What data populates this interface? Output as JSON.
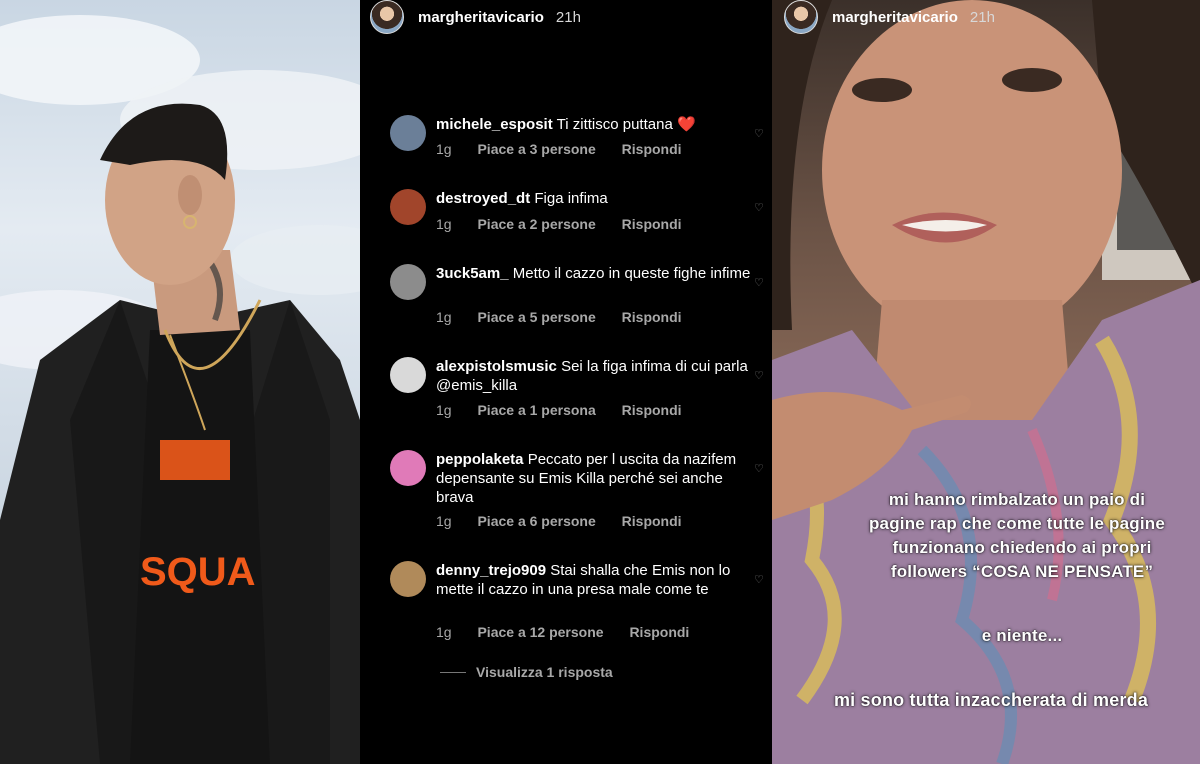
{
  "story": {
    "username": "margheritavicario",
    "time": "21h"
  },
  "comments": [
    {
      "user": "michele_esposit",
      "text": "Ti zittisco puttana ❤️",
      "age": "1g",
      "likes": "Piace a 3 persone",
      "reply": "Rispondi",
      "avatar_color": "#6b7f98"
    },
    {
      "user": "destroyed_dt",
      "text": "Figa infima",
      "age": "1g",
      "likes": "Piace a 2 persone",
      "reply": "Rispondi",
      "avatar_color": "#a1452b"
    },
    {
      "user": "3uck5am_",
      "text": "Metto il cazzo in queste fighe infime",
      "age": "1g",
      "likes": "Piace a 5 persone",
      "reply": "Rispondi",
      "avatar_color": "#8c8c8c"
    },
    {
      "user": "alexpistolsmusic",
      "text": "Sei la figa infima di cui parla @emis_killa",
      "age": "1g",
      "likes": "Piace a 1 persona",
      "reply": "Rispondi",
      "avatar_color": "#d9d9d9"
    },
    {
      "user": "peppolaketa",
      "text": "Peccato per l uscita da nazifem depensante su Emis Killa perché sei anche brava",
      "age": "1g",
      "likes": "Piace a 6 persone",
      "reply": "Rispondi",
      "avatar_color": "#e07ab8"
    },
    {
      "user": "denny_trejo909",
      "text": "Stai shalla che Emis non lo mette il cazzo in una presa male come te",
      "age": "1g",
      "likes": "Piace a 12 persone",
      "reply": "Rispondi",
      "avatar_color": "#b08a5a"
    }
  ],
  "view_replies": "Visualizza 1 risposta",
  "overlay": {
    "line1": "mi hanno rimbalzato un paio di",
    "line2": "pagine rap che come tutte le pagine",
    "line3": "funzionano chiedendo ai propri",
    "line4": "followers “COSA NE PENSATE”",
    "line5": "e niente...",
    "line6": "mi sono tutta inzaccherata di merda"
  },
  "photo": {
    "shirt_text": "SQUA"
  }
}
